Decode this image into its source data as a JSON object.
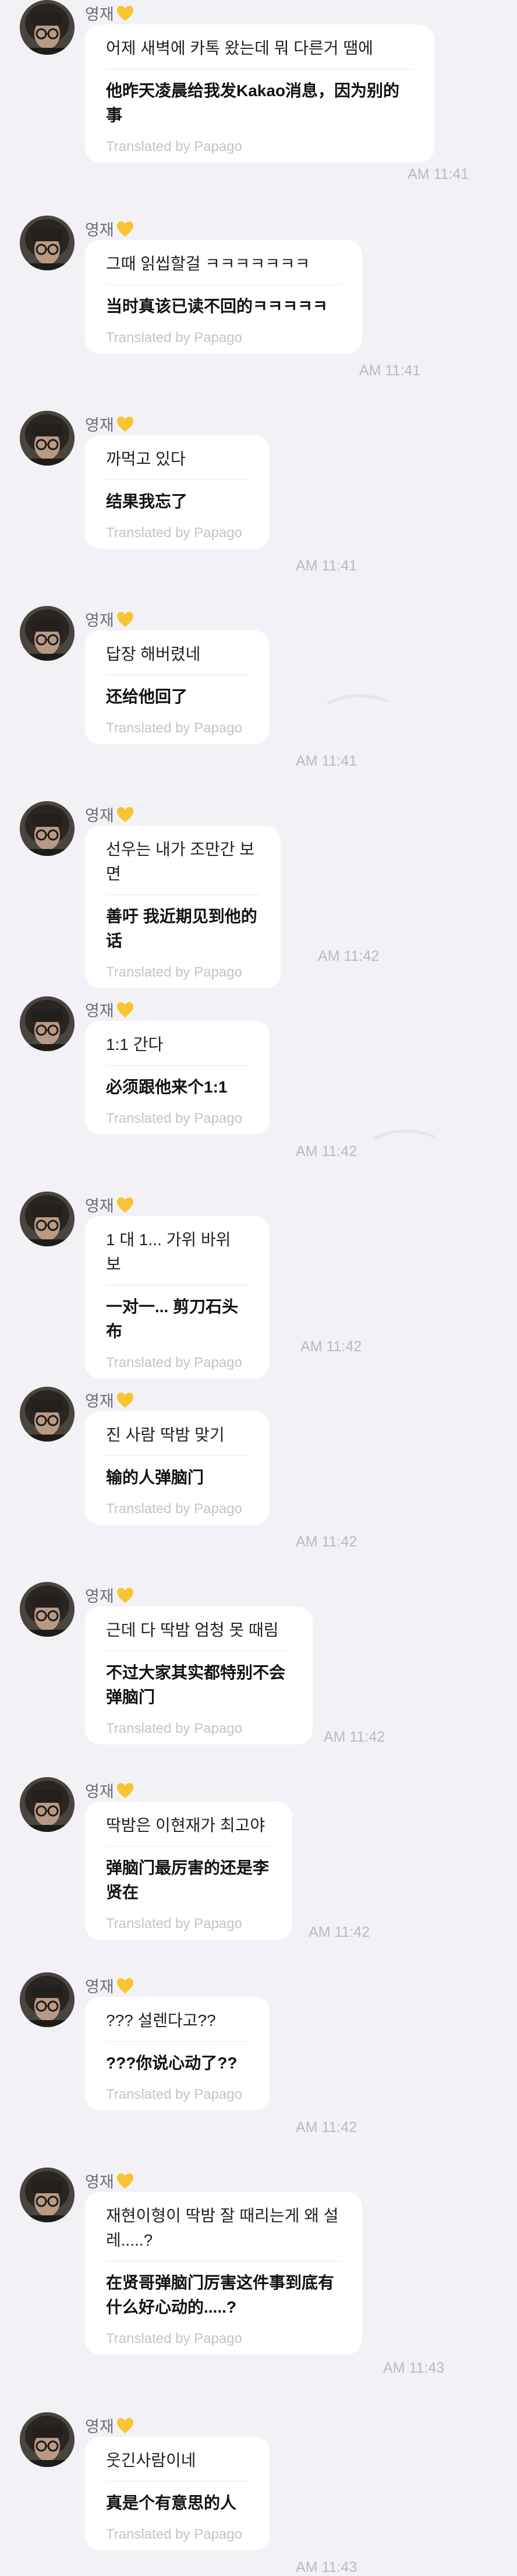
{
  "sender_name": "영재",
  "translation_credit": "Translated by Papago",
  "colors": {
    "background": "#f2f1f6",
    "bubble": "#ffffff",
    "heart": "#f7c531",
    "timestamp": "#b9b9be"
  },
  "messages": [
    {
      "original": "어제 새벽에 카톡 왔는데 뭐 다른거 땜에",
      "translated": "他昨天凌晨给我发Kakao消息，因为别的事",
      "time": "AM 11:41"
    },
    {
      "original": "그때 읽씹할걸 ㅋㅋㅋㅋㅋㅋㅋ",
      "translated": "当时真该已读不回的ㅋㅋㅋㅋㅋ",
      "time": "AM 11:41"
    },
    {
      "original": "까먹고 있다",
      "translated": "结果我忘了",
      "time": "AM 11:41"
    },
    {
      "original": "답장 해버렸네",
      "translated": "还给他回了",
      "time": "AM 11:41"
    },
    {
      "original": "선우는 내가 조만간 보면",
      "translated": "善吁 我近期见到他的话",
      "time": "AM 11:42"
    },
    {
      "original": "1:1 간다",
      "translated": "必须跟他来个1:1",
      "time": "AM 11:42"
    },
    {
      "original": "1 대 1... 가위 바위 보",
      "translated": "一对一... 剪刀石头布",
      "time": "AM 11:42"
    },
    {
      "original": "진 사람 딱밤 맞기",
      "translated": "输的人弹脑门",
      "time": "AM 11:42"
    },
    {
      "original": "근데 다 딱밤 엄청 못 때림",
      "translated": "不过大家其实都特别不会弹脑门",
      "time": "AM 11:42"
    },
    {
      "original": "딱밤은 이현재가 최고야",
      "translated": "弹脑门最厉害的还是李贤在",
      "time": "AM 11:42"
    },
    {
      "original": "??? 설렌다고??",
      "translated": "???你说心动了??",
      "time": "AM 11:42"
    },
    {
      "original": "재현이형이 딱밤 잘 때리는게 왜 설레.....?",
      "translated": "在贤哥弹脑门厉害这件事到底有什么好心动的.....?",
      "time": "AM 11:43"
    },
    {
      "original": "웃긴사람이네",
      "translated": "真是个有意思的人",
      "time": "AM 11:43"
    }
  ]
}
